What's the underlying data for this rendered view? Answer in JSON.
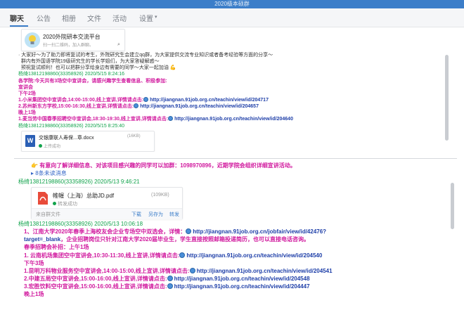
{
  "window": {
    "title": "2020级本硕群"
  },
  "tabs": [
    "聊天",
    "公告",
    "相册",
    "文件",
    "活动",
    "设置"
  ],
  "group_card": {
    "name": "2020外院研本交流平台",
    "hint": "扫一扫二维码，加入群聊。"
  },
  "messages": {
    "intro": [
      "大家好～为了助力即将复试的考生，外院研究生会建立qq群，为大家提供交流专业知识或者备考经验等方面的分享～",
      "群内有外国语学院19级研究生的学长学姐们，为大家答疑解惑～",
      "预祝复试顺利！也可以把群分享给身边有需要的同学～大家一起加油"
    ],
    "sender1": "杨绮13812198860(33358926) 2020/5/15 8:24:16",
    "notice_title": "各学院:今天共有3场空中宣讲会，请感兴趣学生查看信息、积极参加:",
    "notice_sub1": "宣讲会",
    "notice_sub2": "下午2场",
    "talks_a": [
      {
        "text": "1.小米集团空中宣讲会,14:00-15:00,线上宣讲,详情请点击:",
        "url": "http://jiangnan.91job.org.cn/teachin/view/id/204717"
      },
      {
        "text": "2.苏州新东方学校,15:00-16:30,线上宣讲,详情请点击:",
        "url": "http://jiangnan.91job.org.cn/teachin/view/id/204657"
      }
    ],
    "notice_sub3": "晚上1场",
    "talks_b": [
      {
        "text": "1.麦当劳中国春季招聘空中宣讲会,18:30-19:30,线上宣讲,详情请点击:",
        "url": "http://jiangnan.91job.org.cn/teachin/view/id/204640"
      }
    ],
    "sender2": "杨绮13812198860(33358926) 2020/5/15 8:25:40",
    "file1": {
      "name": "交银康联人寿保...章.docx",
      "size": "(16KB)",
      "status": "上传成功"
    },
    "upload_notice": "有意向了解详细信息、对该项目感兴趣的同学可以加群：1098970896，近期学院会组织详细宣讲活动。",
    "show_more": "8条未读消息",
    "sender3": "杨绮13812198860(33358926) 2020/5/13 9:46:21",
    "file2": {
      "name": "帷幄（上海）总助JD.pdf",
      "size": "(109KB)",
      "status": "转发成功",
      "source": "来自群文件",
      "actions": [
        "下载",
        "另存为",
        "转发"
      ]
    },
    "sender4": "杨绮13812198860(33358926) 2020/5/13 10:06:18",
    "fair": {
      "text": "1、江南大学2020年春季上海校友会企业专场空中双选会，详情：",
      "url": "http://jiangnan.91job.org.cn/jobfair/view/id/42476?",
      "target": "target=_blank",
      "text2": "，企业招聘岗位只针对江南大学2020届毕业生，学生直接按照邮箱投递简历，也可以直接电话咨询。",
      "tail": "春季招聘会补招：上午1场"
    },
    "talks_c": [
      {
        "text": "1. 云南机场集团空中宣讲会,10:30-11:30,线上宣讲,详情请点击:",
        "url": "http://jiangnan.91job.org.cn/teachin/view/id/204540"
      }
    ],
    "afternoon3": "下午3场",
    "talks_d": [
      {
        "text": "1.昆明万科物业服务空中宣讲会,14:00-15:00,线上宣讲,详情请点击:",
        "url": "http://jiangnan.91job.org.cn/teachin/view/id/204541"
      },
      {
        "text": "2.中建五局空中宣讲会,15:00-16:00,线上宣讲,详情请点击:",
        "url": "http://jiangnan.91job.org.cn/teachin/view/id/204548"
      },
      {
        "text": "3.宏胜饮料空中宣讲会,15:00-16:00,线上宣讲,详情请点击:",
        "url": "http://jiangnan.91job.org.cn/teachin/view/id/204447"
      }
    ],
    "evening1": "晚上1场"
  },
  "colors": {
    "accent": "#3c7ec9",
    "pink": "#d1199e",
    "green": "#12a34c",
    "link": "#1d3ea8"
  }
}
